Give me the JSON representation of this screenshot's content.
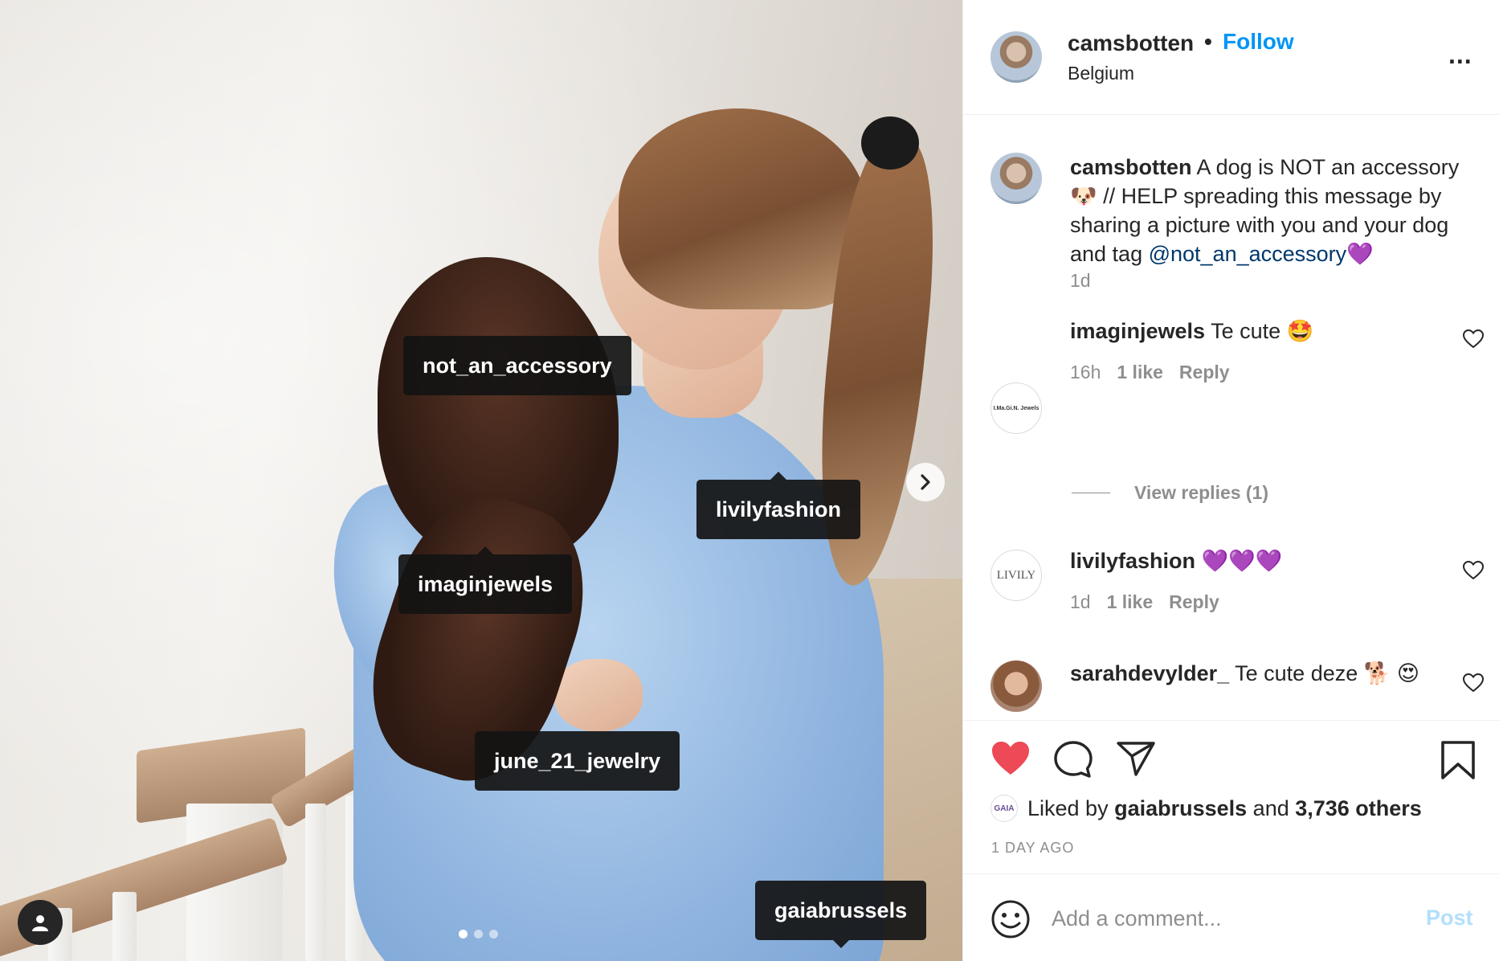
{
  "post_image": {
    "tags": [
      {
        "label": "not_an_accessory"
      },
      {
        "label": "livilyfashion"
      },
      {
        "label": "imaginjewels"
      },
      {
        "label": "june_21_jewelry"
      },
      {
        "label": "gaiabrussels"
      }
    ],
    "carousel": {
      "count": 3,
      "active_index": 1
    },
    "icons": {
      "next": "chevron-right-icon",
      "tagged_users": "person-icon"
    }
  },
  "header": {
    "username": "camsbotten",
    "separator": "•",
    "follow_label": "Follow",
    "location": "Belgium",
    "more_label": "..."
  },
  "caption": {
    "username": "camsbotten",
    "text": " A dog is NOT an accessory🐶 // HELP spreading this message by sharing a picture with you and your dog and tag ",
    "mention": "@not_an_accessory",
    "emoji_end": "💜",
    "time": "1d"
  },
  "comments": [
    {
      "username": "imaginjewels",
      "text": " Te cute 🤩",
      "time": "16h",
      "likes": "1 like",
      "reply": "Reply",
      "avatar_text": "I.Ma.Gi.N. Jewels"
    },
    {
      "username": "livilyfashion",
      "text": " 💜💜💜",
      "time": "1d",
      "likes": "1 like",
      "reply": "Reply",
      "avatar_text": "LIVILY"
    },
    {
      "username": "sarahdevylder_",
      "text": " Te cute deze 🐕 😍"
    }
  ],
  "view_replies": "View replies (1)",
  "actions": {
    "liked": true,
    "like_color": "#ed4956",
    "liked_by_prefix": "Liked by ",
    "liked_by_user": "gaiabrussels",
    "and": " and ",
    "others": "3,736 others",
    "time_ago": "1 DAY AGO",
    "likes_avatar_text": "GAIA"
  },
  "add_comment": {
    "placeholder": "Add a comment...",
    "post_label": "Post"
  },
  "colors": {
    "link_blue": "#0095f6",
    "mention_blue": "#00376b",
    "muted": "#8e8e8e",
    "post_disabled": "#b2dffc"
  }
}
